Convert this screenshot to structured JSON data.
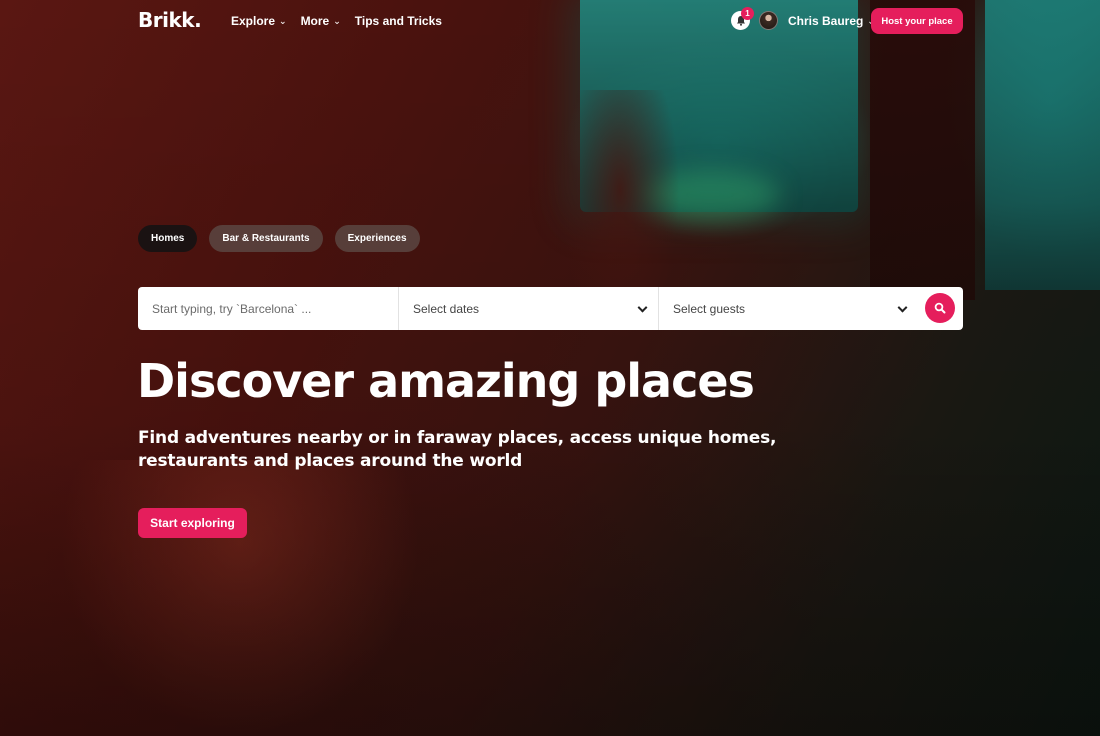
{
  "header": {
    "logo": "Brikk.",
    "menu": [
      {
        "label": "Explore",
        "has_dropdown": true
      },
      {
        "label": "More",
        "has_dropdown": true
      },
      {
        "label": "Tips and Tricks",
        "has_dropdown": false
      }
    ],
    "notification_count": "1",
    "user_name": "Chris Baureg",
    "host_button": "Host your place"
  },
  "categories": [
    {
      "label": "Homes",
      "active": true
    },
    {
      "label": "Bar & Restaurants",
      "active": false
    },
    {
      "label": "Experiences",
      "active": false
    }
  ],
  "search": {
    "where_placeholder": "Start typing, try `Barcelona` ...",
    "dates_label": "Select dates",
    "guests_label": "Select guests"
  },
  "hero": {
    "title": "Discover amazing places",
    "subtitle": "Find adventures nearby or in faraway places, access unique homes, restaurants and places around the world",
    "cta": "Start exploring"
  },
  "colors": {
    "accent": "#e51e5c",
    "pill_active": "#1a1212",
    "pill_inactive": "#5a4642"
  },
  "icons": [
    "bell-icon",
    "chevron-down-icon",
    "search-icon"
  ]
}
